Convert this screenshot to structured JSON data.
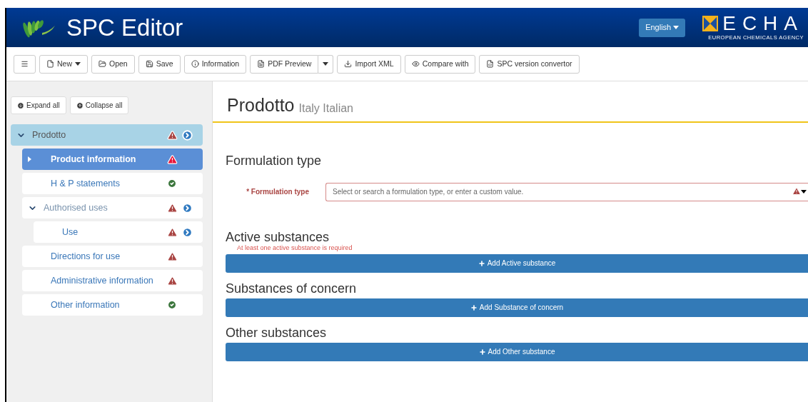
{
  "header": {
    "title": "SPC Editor",
    "language": "English",
    "agency_logo": {
      "letters": "ECHA",
      "subtitle": "EUROPEAN CHEMICALS AGENCY"
    }
  },
  "toolbar": [
    {
      "kind": "icon"
    },
    {
      "kind": "dropdown",
      "label": "New"
    },
    {
      "kind": "plain",
      "label": "Open"
    },
    {
      "kind": "plain",
      "label": "Save"
    },
    {
      "kind": "plain",
      "label": "Information"
    },
    {
      "kind": "split",
      "label": "PDF Preview"
    },
    {
      "kind": "plain",
      "label": "Import XML"
    },
    {
      "kind": "plain",
      "label": "Compare with"
    },
    {
      "kind": "plain",
      "label": "SPC version convertor"
    }
  ],
  "sidebar": {
    "buttons": [
      "Expand all",
      "Collapse all"
    ],
    "tree": [
      {
        "label": "Prodotto",
        "has_errors": true,
        "navigable": true,
        "expanded": true,
        "selected": false,
        "children": [
          {
            "label": "Product information",
            "has_errors": true,
            "navigable": false,
            "selected": true
          },
          {
            "label": "H & P statements",
            "has_errors": false,
            "navigable": false,
            "selected": false
          },
          {
            "label": "Authorised uses",
            "has_errors": true,
            "navigable": true,
            "expanded": true,
            "selected": false,
            "children": [
              {
                "label": "Use",
                "has_errors": true,
                "navigable": true,
                "selected": false
              }
            ]
          },
          {
            "label": "Directions for use",
            "has_errors": true,
            "navigable": false,
            "selected": false
          },
          {
            "label": "Administrative information",
            "has_errors": true,
            "navigable": false,
            "selected": false
          },
          {
            "label": "Other information",
            "has_errors": false,
            "navigable": false,
            "selected": false
          }
        ]
      }
    ]
  },
  "content": {
    "title": "Prodotto",
    "subtitle": "Italy Italian",
    "sections": [
      {
        "kind": "field",
        "heading": "Formulation type",
        "label": "* Formulation type",
        "placeholder": "Select or search a formulation type, or enter a custom value.",
        "invalid": true
      },
      {
        "kind": "add",
        "heading": "Active substances",
        "error": "At least one active substance is required",
        "button": "Add Active substance"
      },
      {
        "kind": "add",
        "heading": "Substances of concern",
        "button": "Add Substance of concern"
      },
      {
        "kind": "add",
        "heading": "Other substances",
        "button": "Add Other substance"
      }
    ]
  }
}
